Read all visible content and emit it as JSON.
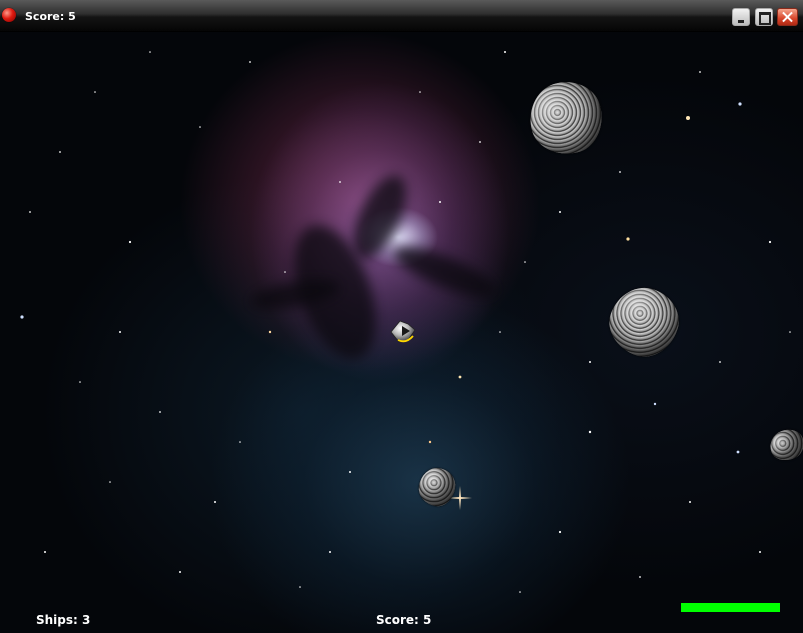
{
  "window": {
    "title": "Score: 5",
    "buttons": {
      "minimize": "minimize",
      "maximize": "maximize",
      "close": "close"
    }
  },
  "hud": {
    "ships": "Ships: 3",
    "score": "Score: 5",
    "health_fraction": 1.0,
    "health_color": "#00ff00"
  },
  "icons": {
    "app": "red-orb-icon",
    "minimize": "minimize-icon",
    "maximize": "maximize-icon",
    "close": "close-icon"
  }
}
